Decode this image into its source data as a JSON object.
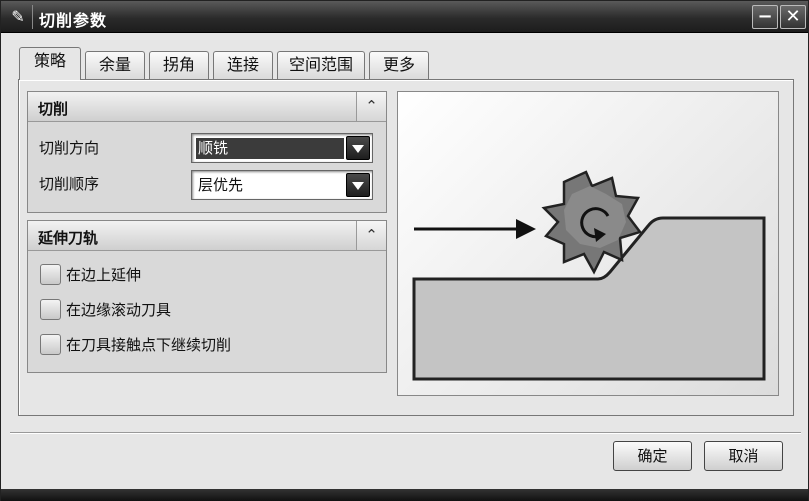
{
  "window": {
    "title": "切削参数"
  },
  "tabs": [
    {
      "label": "策略",
      "active": true
    },
    {
      "label": "余量",
      "active": false
    },
    {
      "label": "拐角",
      "active": false
    },
    {
      "label": "连接",
      "active": false
    },
    {
      "label": "空间范围",
      "active": false
    },
    {
      "label": "更多",
      "active": false
    }
  ],
  "cut_group": {
    "title": "切削",
    "fields": [
      {
        "label": "切削方向",
        "value": "顺铣"
      },
      {
        "label": "切削顺序",
        "value": "层优先"
      }
    ]
  },
  "extend_group": {
    "title": "延伸刀轨",
    "options": [
      {
        "label": "在边上延伸",
        "checked": false
      },
      {
        "label": "在边缘滚动刀具",
        "checked": false
      },
      {
        "label": "在刀具接触点下继续切削",
        "checked": false
      }
    ]
  },
  "buttons": {
    "ok": "确定",
    "cancel": "取消"
  },
  "icons": {
    "title": "pencil-icon",
    "minimize": "minimize-icon",
    "close": "close-icon",
    "collapse": "chevron-up-icon"
  }
}
